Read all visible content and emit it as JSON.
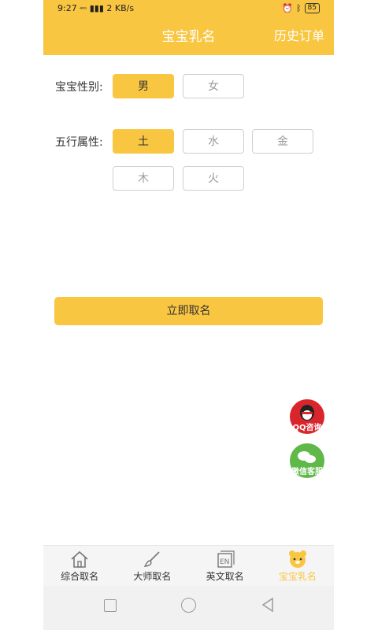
{
  "status": {
    "time": "9:27",
    "net": "⁴⁶ᴳ",
    "speed": "2 KB/s",
    "battery": "85"
  },
  "header": {
    "title": "宝宝乳名",
    "history": "历史订单"
  },
  "gender": {
    "label": "宝宝性别:",
    "options": [
      "男",
      "女"
    ],
    "selected": "男"
  },
  "element": {
    "label": "五行属性:",
    "options": [
      "土",
      "水",
      "金",
      "木",
      "火"
    ],
    "selected": "土"
  },
  "cta": "立即取名",
  "floats": {
    "qq": "QQ咨询",
    "wechat": "微信客服"
  },
  "tabs": [
    {
      "label": "综合取名",
      "icon": "home-icon"
    },
    {
      "label": "大师取名",
      "icon": "brush-icon"
    },
    {
      "label": "英文取名",
      "icon": "en-icon"
    },
    {
      "label": "宝宝乳名",
      "icon": "bear-icon",
      "active": true
    }
  ],
  "colors": {
    "accent": "#f9c642"
  }
}
